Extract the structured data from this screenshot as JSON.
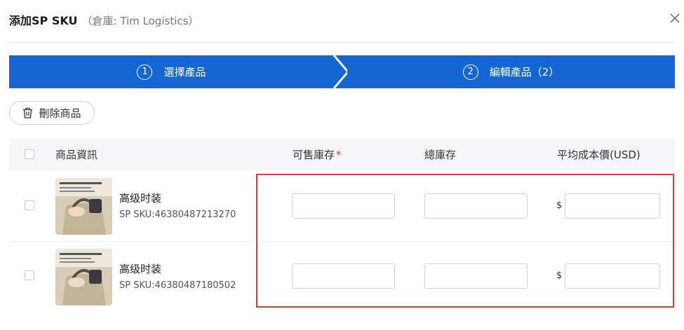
{
  "header": {
    "title": "添加SP SKU",
    "subtitle": "（倉庫: Tim Logistics）"
  },
  "steps": [
    {
      "num": "1",
      "label": "選擇產品"
    },
    {
      "num": "2",
      "label": "編輯產品（2）"
    }
  ],
  "toolbar": {
    "delete_label": "刪除商品"
  },
  "table": {
    "columns": {
      "info": "商品資訊",
      "available_stock": "可售庫存",
      "required_mark": "*",
      "total_stock": "總庫存",
      "avg_cost": "平均成本價(USD)"
    },
    "currency_symbol": "$",
    "rows": [
      {
        "name": "高级时装",
        "sku": "SP SKU:46380487213270",
        "available": "",
        "total": "",
        "cost": ""
      },
      {
        "name": "高级时装",
        "sku": "SP SKU:46380487180502",
        "available": "",
        "total": "",
        "cost": ""
      }
    ]
  },
  "colors": {
    "accent": "#1565d3",
    "highlight": "#e0383e"
  }
}
